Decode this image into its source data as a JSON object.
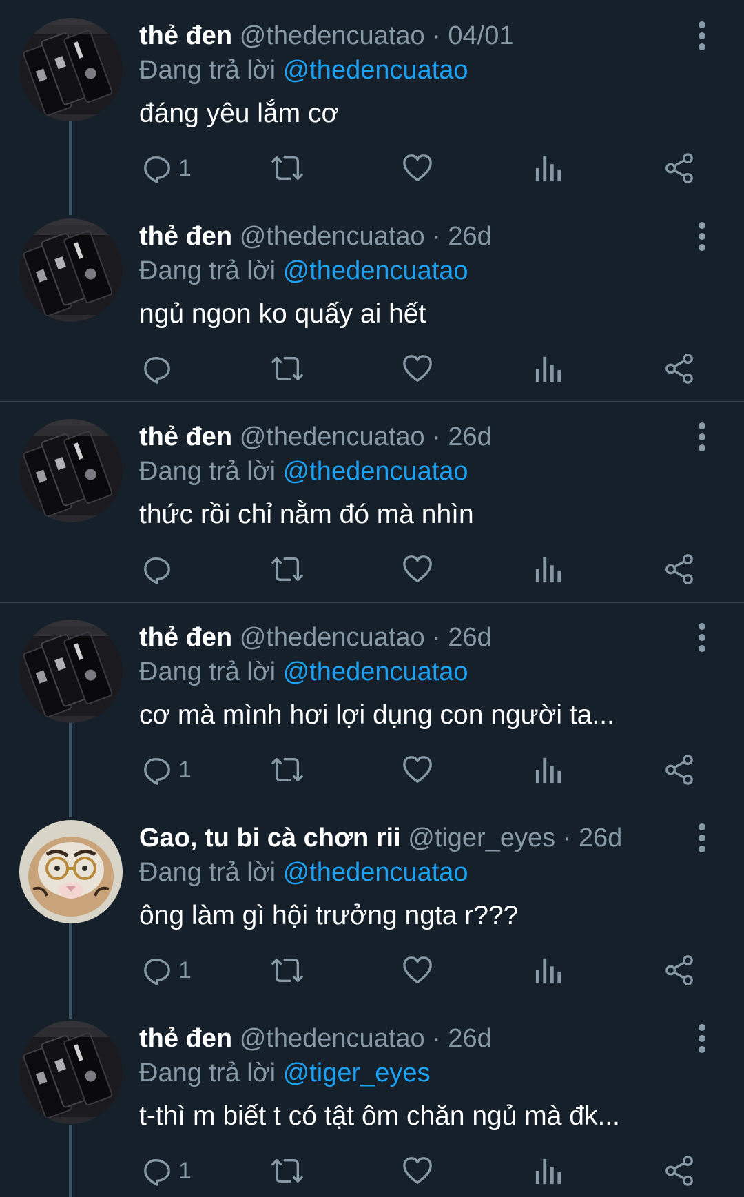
{
  "colors": {
    "background": "#15202b",
    "muted": "#8899a6",
    "link": "#1da1f2",
    "divider": "#38444d",
    "thread_line": "#3d5466"
  },
  "reply_prefix": "Đang trả lời",
  "tweets": [
    {
      "name": "thẻ đen",
      "handle": "@thedencuatao",
      "dot": "·",
      "time": "04/01",
      "reply_to": "@thedencuatao",
      "text": "đáng yêu lắm cơ",
      "reply_count": "1",
      "avatar": "cards"
    },
    {
      "name": "thẻ đen",
      "handle": "@thedencuatao",
      "dot": "·",
      "time": "26d",
      "reply_to": "@thedencuatao",
      "text": "ngủ ngon ko quấy ai hết",
      "reply_count": "",
      "avatar": "cards"
    },
    {
      "name": "thẻ đen",
      "handle": "@thedencuatao",
      "dot": "·",
      "time": "26d",
      "reply_to": "@thedencuatao",
      "text": "thức rồi chỉ nằm đó mà nhìn",
      "reply_count": "",
      "avatar": "cards"
    },
    {
      "name": "thẻ đen",
      "handle": "@thedencuatao",
      "dot": "·",
      "time": "26d",
      "reply_to": "@thedencuatao",
      "text": "cơ mà mình hơi lợi dụng con người ta...",
      "reply_count": "1",
      "avatar": "cards"
    },
    {
      "name": "Gao, tu bi cà chơn rii",
      "handle": "@tiger_eyes",
      "dot": "·",
      "time": "26d",
      "reply_to": "@thedencuatao",
      "text": "ông làm gì hội trưởng ngta r???",
      "reply_count": "1",
      "avatar": "tiger"
    },
    {
      "name": "thẻ đen",
      "handle": "@thedencuatao",
      "dot": "·",
      "time": "26d",
      "reply_to": "@tiger_eyes",
      "text": "t-thì m biết t có tật ôm chăn ngủ mà đk...",
      "reply_count": "1",
      "avatar": "cards"
    }
  ],
  "icons": [
    "reply-icon",
    "retweet-icon",
    "like-icon",
    "analytics-icon",
    "share-icon",
    "more-options-icon"
  ]
}
